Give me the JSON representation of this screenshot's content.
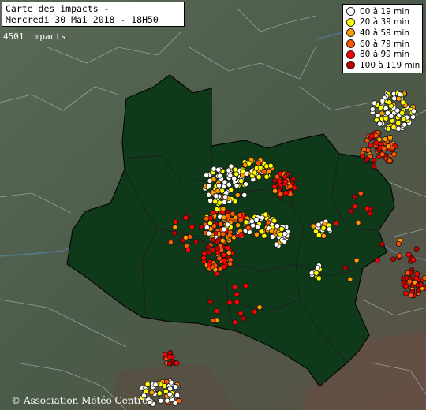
{
  "title": {
    "line1": "Carte des impacts -",
    "line2": "Mercredi 30 Mai 2018 - 18H50"
  },
  "impact_count": "4501 impacts",
  "legend": {
    "items": [
      {
        "label": "00 à 19 min",
        "color": "#ffffff"
      },
      {
        "label": "20 à 39 min",
        "color": "#ffff00"
      },
      {
        "label": "40 à 59 min",
        "color": "#ff9900"
      },
      {
        "label": "60 à 79 min",
        "color": "#ff5500"
      },
      {
        "label": "80 à 99 min",
        "color": "#ff0000"
      },
      {
        "label": "100 à 119 min",
        "color": "#bb0000"
      }
    ]
  },
  "copyright": "© Association Météo Centre",
  "colors": {
    "terrain": "#4f5e4c",
    "region": "#0f3a1a",
    "borders": "#a8b4aa",
    "rivers": "#5a7fa8"
  }
}
